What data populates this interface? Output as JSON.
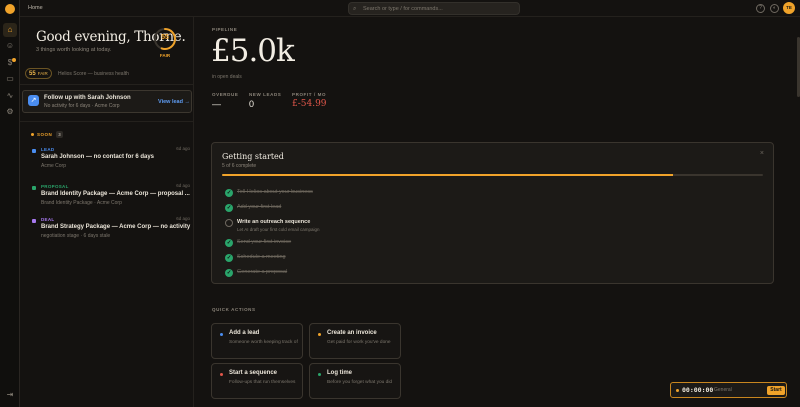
{
  "topbar": {
    "breadcrumb": "Home",
    "search_placeholder": "Search or type / for commands...",
    "avatar_initials": "TE"
  },
  "greeting": {
    "title": "Good evening, Thorne.",
    "subtitle": "3 things worth looking at today.",
    "score": "55",
    "score_fraction": 0.55,
    "score_label": "FAIR",
    "badge_num": "55",
    "badge_label": "FAIR",
    "health_text": "Helios Score — business health"
  },
  "follow_card": {
    "title": "Follow up with Sarah Johnson",
    "subtitle": "No activity for 6 days · Acme Corp",
    "action": "View lead →"
  },
  "soon": {
    "label": "SOON",
    "count": "3"
  },
  "items": [
    {
      "tag": "LEAD",
      "age": "6d ago",
      "title": "Sarah Johnson — no contact for 6 days",
      "sub": "Acme Corp",
      "color": "#4a8df0"
    },
    {
      "tag": "PROPOSAL",
      "age": "6d ago",
      "title": "Brand Identity Package — Acme Corp — proposal ...",
      "sub": "Brand Identity Package · Acme Corp",
      "color": "#2aa56b"
    },
    {
      "tag": "DEAL",
      "age": "6d ago",
      "title": "Brand Strategy Package — Acme Corp — no activity",
      "sub": "negotiation stage · 6 days stale",
      "color": "#a779ef"
    }
  ],
  "pipeline": {
    "label": "PIPELINE",
    "value": "£5.0k",
    "sub": "in open deals"
  },
  "kpis": [
    {
      "label": "OVERDUE",
      "value": "—"
    },
    {
      "label": "NEW LEADS",
      "value": "0"
    },
    {
      "label": "PROFIT / MO",
      "value": "£-54.99"
    }
  ],
  "getting_started": {
    "title": "Getting started",
    "progress_text": "5 of 6 complete",
    "progress": 0.833,
    "close": "×",
    "steps": [
      {
        "text": "Tell Helios about your business",
        "done": true,
        "sub": ""
      },
      {
        "text": "Add your first lead",
        "done": true,
        "sub": ""
      },
      {
        "text": "Write an outreach sequence",
        "done": false,
        "sub": "Let AI draft your first cold email campaign"
      },
      {
        "text": "Send your first invoice",
        "done": true,
        "sub": ""
      },
      {
        "text": "Schedule a meeting",
        "done": true,
        "sub": ""
      },
      {
        "text": "Generate a proposal",
        "done": true,
        "sub": ""
      }
    ]
  },
  "quick_actions": {
    "label": "QUICK ACTIONS",
    "items": [
      {
        "title": "Add a lead",
        "sub": "Someone worth keeping track of",
        "color": "#4a8df0"
      },
      {
        "title": "Create an invoice",
        "sub": "Get paid for work you've done",
        "color": "#f0a32a"
      },
      {
        "title": "Start a sequence",
        "sub": "Follow-ups that run themselves",
        "color": "#e0564a"
      },
      {
        "title": "Log time",
        "sub": "Before you forget what you did",
        "color": "#2aa56b"
      }
    ]
  },
  "timer": {
    "time": "00:00:00",
    "label": "General",
    "button": "Start"
  }
}
